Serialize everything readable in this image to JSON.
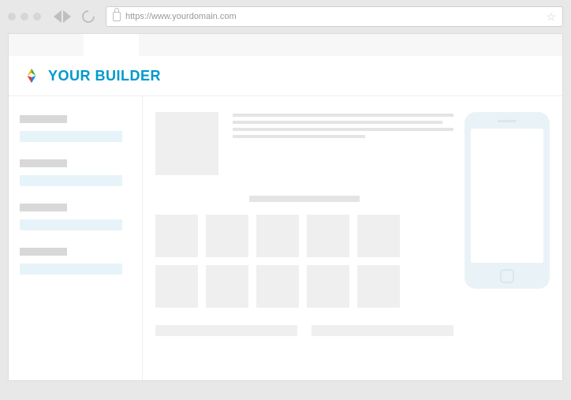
{
  "browser": {
    "url": "https://www.yourdomain.com"
  },
  "header": {
    "brand": "YOUR BUILDER"
  }
}
